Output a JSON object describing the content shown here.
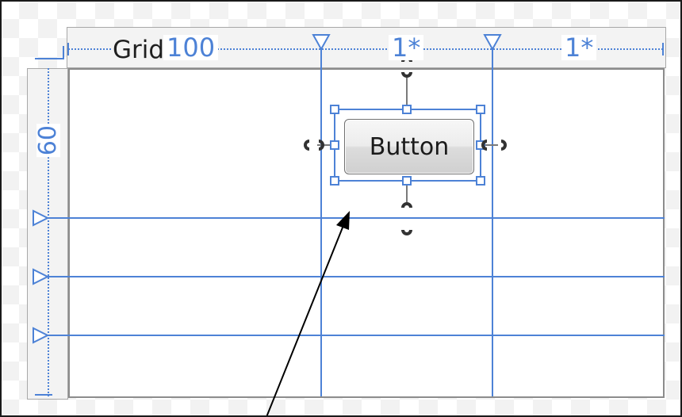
{
  "grid": {
    "label": "Grid",
    "columns": [
      {
        "width": "100"
      },
      {
        "width": "1*"
      },
      {
        "width": "1*"
      }
    ],
    "rows": [
      {
        "height": "60"
      }
    ]
  },
  "button": {
    "label": "Button"
  },
  "colors": {
    "accent": "#4d82d6",
    "grid_border": "#8c8c8c",
    "adorner_bg": "#f3f3f3"
  }
}
